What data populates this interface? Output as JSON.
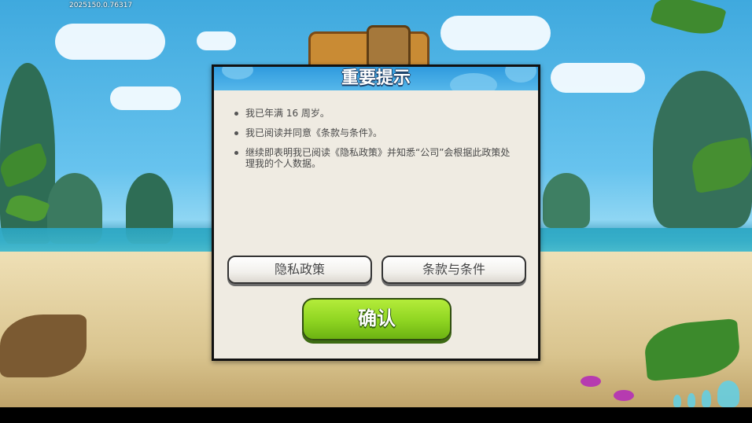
{
  "build_info": "2025150.0.76317",
  "dialog": {
    "title": "重要提示",
    "notices": [
      "我已年满 16 周岁。",
      "我已阅读并同意《条款与条件》。",
      "继续即表明我已阅读《隐私政策》并知悉“公司”会根据此政策处理我的个人数据。"
    ],
    "privacy_button": "隐私政策",
    "terms_button": "条款与条件",
    "confirm_button": "确认"
  },
  "colors": {
    "header_blue": "#3fa6e4",
    "confirm_green": "#8ed421",
    "panel_bg": "#efebe2"
  }
}
